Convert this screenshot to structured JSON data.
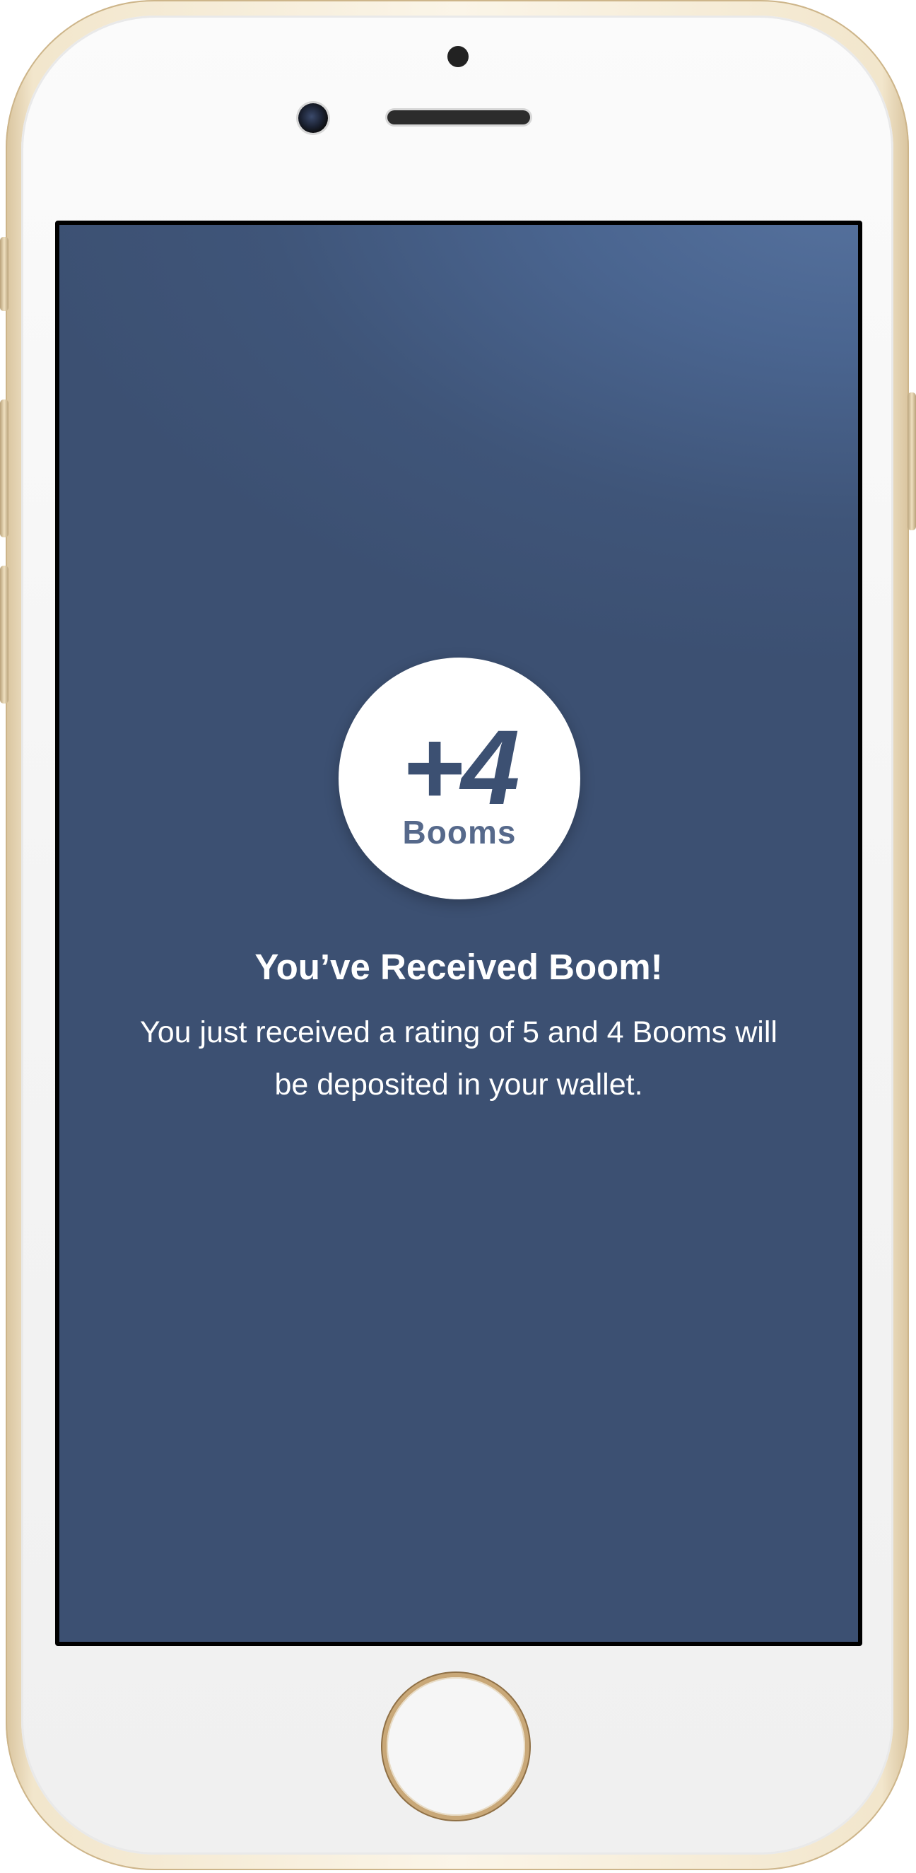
{
  "device": {
    "frame_color": "#e8d7b3",
    "screen_background": "#3c5072"
  },
  "notification": {
    "badge": {
      "amount": "+4",
      "unit": "Booms"
    },
    "title": "You’ve Received Boom!",
    "message": "You just received a rating of 5 and 4 Booms will be deposited in your wallet."
  }
}
